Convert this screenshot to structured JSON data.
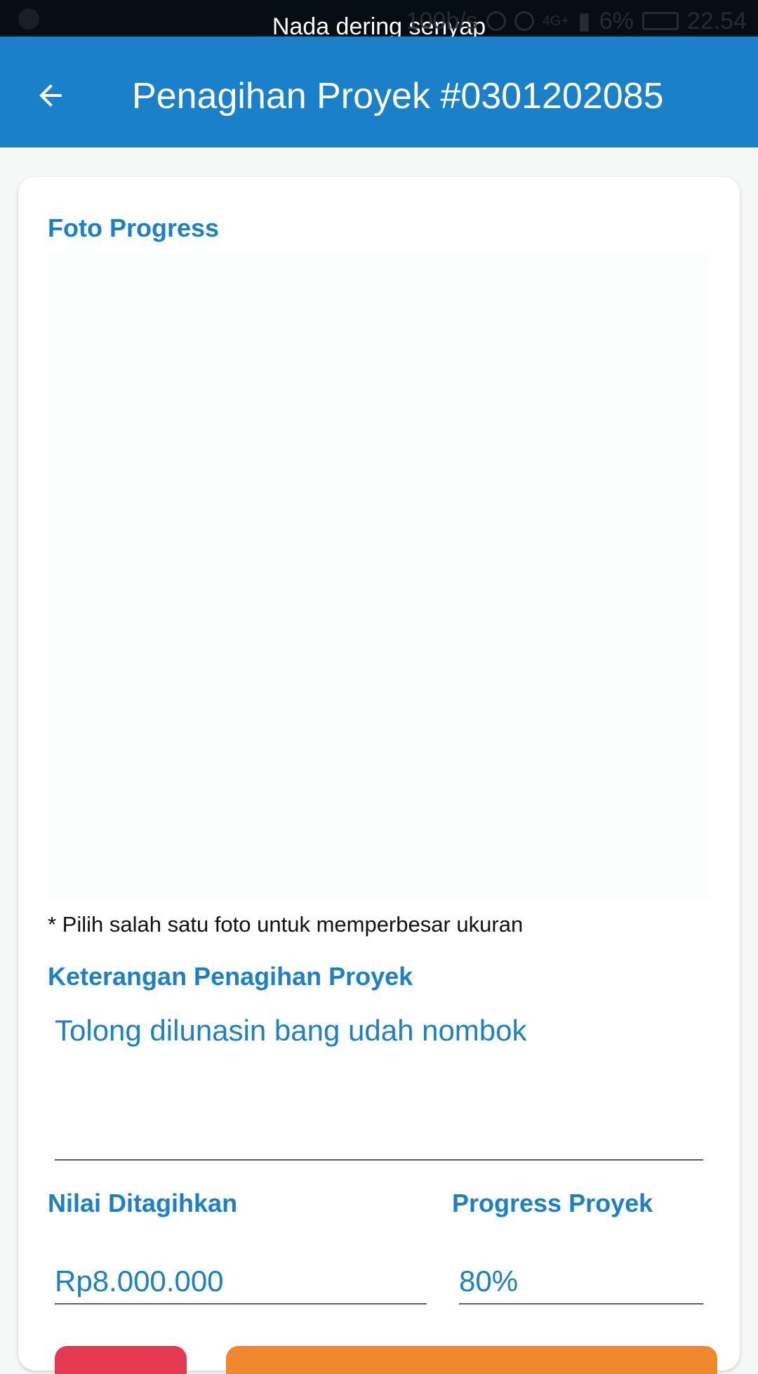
{
  "status_bar": {
    "notification": "Nada dering senyap",
    "speed": "100b/s",
    "network": "4G+",
    "battery": "6%",
    "time": "22.54"
  },
  "app_bar": {
    "title": "Penagihan Proyek #0301202085"
  },
  "card": {
    "photo_label": "Foto Progress",
    "photo_hint": "* Pilih salah satu foto untuk memperbesar ukuran",
    "description_label": "Keterangan Penagihan Proyek",
    "description_value": "Tolong dilunasin bang udah nombok",
    "amount_label": "Nilai Ditagihkan",
    "amount_value": "Rp8.000.000",
    "progress_label": "Progress Proyek",
    "progress_value": "80%"
  },
  "colors": {
    "primary": "#1a80c9",
    "reject_button": "#e53950",
    "approve_button": "#f0882e"
  }
}
